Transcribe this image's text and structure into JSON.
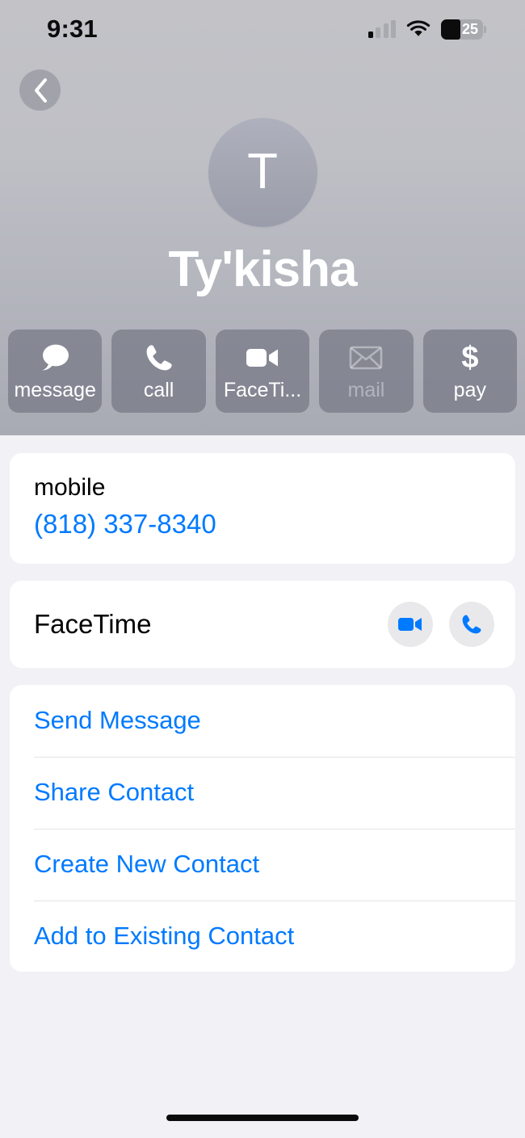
{
  "status_bar": {
    "time": "9:31",
    "cellular_icon": "cellular-signal-icon",
    "cellular_bars_active": 1,
    "wifi_icon": "wifi-icon",
    "battery_icon": "battery-icon",
    "battery_percent": "25"
  },
  "header": {
    "back_icon": "chevron-left-icon",
    "avatar_initial": "T",
    "contact_name": "Ty'kisha",
    "background_color": "#b5b7be"
  },
  "quick_actions": [
    {
      "label": "message",
      "icon": "message-bubble-icon",
      "enabled": true
    },
    {
      "label": "call",
      "icon": "phone-icon",
      "enabled": true
    },
    {
      "label": "FaceTi...",
      "icon": "video-camera-icon",
      "enabled": true
    },
    {
      "label": "mail",
      "icon": "envelope-icon",
      "enabled": false
    },
    {
      "label": "pay",
      "icon": "dollar-sign-icon",
      "enabled": true
    }
  ],
  "phone_card": {
    "label": "mobile",
    "number": "(818) 337-8340"
  },
  "facetime_card": {
    "label": "FaceTime",
    "video_icon": "video-camera-icon",
    "audio_icon": "phone-icon"
  },
  "action_list": [
    {
      "label": "Send Message"
    },
    {
      "label": "Share Contact"
    },
    {
      "label": "Create New Contact"
    },
    {
      "label": "Add to Existing Contact"
    }
  ],
  "colors": {
    "accent_blue": "#007aff",
    "background": "#f1f1f6",
    "card": "#ffffff"
  }
}
